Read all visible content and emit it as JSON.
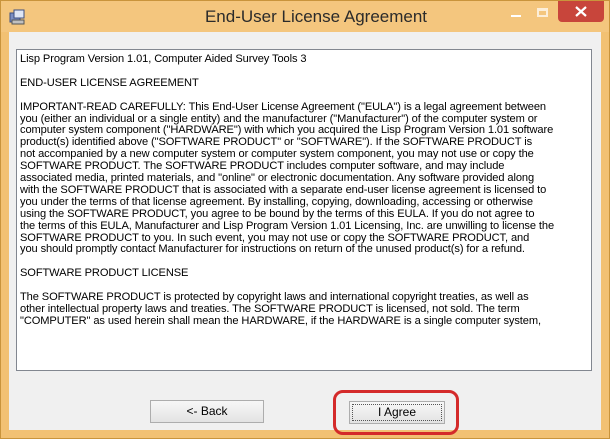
{
  "window": {
    "title": "End-User License Agreement",
    "icon": "setup-icon",
    "controls": [
      "minimize",
      "maximize",
      "close"
    ]
  },
  "license": {
    "lines": [
      "Lisp Program Version 1.01, Computer Aided Survey Tools 3",
      "END-USER LICENSE AGREEMENT",
      "IMPORTANT-READ CAREFULLY: This End-User License Agreement (\"EULA\") is a legal agreement between",
      "you (either an individual or a single entity) and the manufacturer (\"Manufacturer\") of the computer system or",
      "computer system component (\"HARDWARE\") with which you acquired the Lisp Program Version 1.01 software",
      "product(s) identified above (\"SOFTWARE PRODUCT\" or \"SOFTWARE\"). If the SOFTWARE PRODUCT is",
      "not accompanied by a new computer system or computer system component, you may not use or copy the",
      "SOFTWARE PRODUCT. The SOFTWARE PRODUCT includes computer software, and may include",
      "associated media, printed materials, and \"online\" or electronic documentation. Any software provided along",
      "with the SOFTWARE PRODUCT that is associated with a separate end-user license agreement is licensed to",
      "you under the terms of that license agreement. By installing, copying, downloading, accessing or otherwise",
      "using the SOFTWARE PRODUCT, you agree to be bound by the terms of this EULA.  If you do not agree to",
      "the terms of this EULA, Manufacturer and Lisp Program Version 1.01 Licensing, Inc. are unwilling to license the",
      "SOFTWARE PRODUCT to you. In such event, you may not use or copy the SOFTWARE PRODUCT, and",
      "you should promptly contact Manufacturer for instructions on return of the unused product(s) for a refund.",
      "SOFTWARE PRODUCT LICENSE",
      "The SOFTWARE PRODUCT is protected by copyright laws and international copyright treaties, as well as",
      "other intellectual property laws and treaties. The SOFTWARE PRODUCT is licensed, not sold. The term",
      "\"COMPUTER\" as used herein shall mean the HARDWARE, if the HARDWARE is a single computer system,"
    ]
  },
  "buttons": {
    "back_label": "<- Back",
    "agree_label": "I Agree"
  },
  "scrollbar": {
    "up_icon": "scroll-up-arrow-icon",
    "down_icon": "scroll-down-arrow-icon"
  },
  "annotation": {
    "highlight_color": "#d42a2a"
  }
}
